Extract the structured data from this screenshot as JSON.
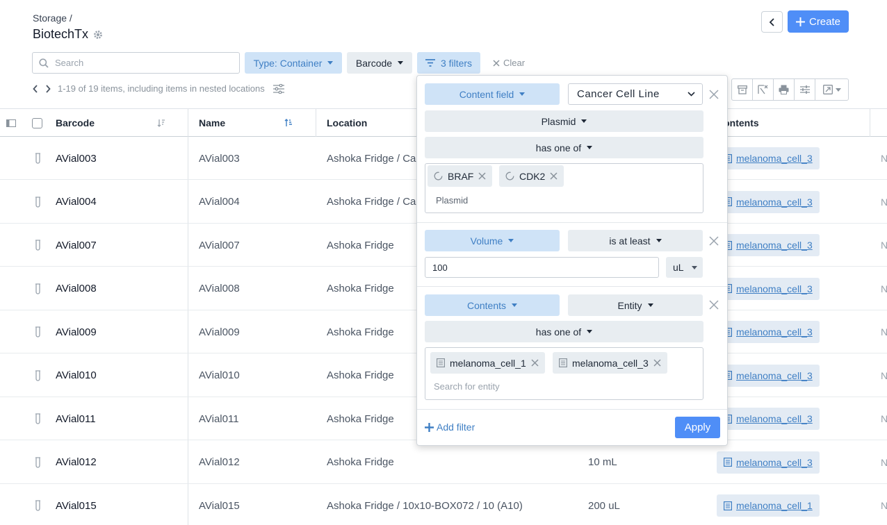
{
  "header": {
    "breadcrumb": "Storage /",
    "title": "BiotechTx",
    "create_label": "Create"
  },
  "toolbar": {
    "search_placeholder": "Search",
    "type_filter": "Type: Container",
    "barcode_filter": "Barcode",
    "filters_label": "3 filters",
    "clear_label": "Clear"
  },
  "pager": {
    "text": "1-19 of 19 items, including items in nested locations"
  },
  "table": {
    "columns": [
      "Barcode",
      "Name",
      "Location",
      "Contents"
    ],
    "rows": [
      {
        "barcode": "AVial003",
        "name": "AVial003",
        "location": "Ashoka Fridge / Ca",
        "volume": "",
        "contents": "melanoma_cell_3",
        "edge": "N"
      },
      {
        "barcode": "AVial004",
        "name": "AVial004",
        "location": "Ashoka Fridge / Ca",
        "volume": "",
        "contents": "melanoma_cell_3",
        "edge": "N"
      },
      {
        "barcode": "AVial007",
        "name": "AVial007",
        "location": "Ashoka Fridge",
        "volume": "",
        "contents": "melanoma_cell_3",
        "edge": "N"
      },
      {
        "barcode": "AVial008",
        "name": "AVial008",
        "location": "Ashoka Fridge",
        "volume": "",
        "contents": "melanoma_cell_3",
        "edge": "N"
      },
      {
        "barcode": "AVial009",
        "name": "AVial009",
        "location": "Ashoka Fridge",
        "volume": "",
        "contents": "melanoma_cell_3",
        "edge": "N"
      },
      {
        "barcode": "AVial010",
        "name": "AVial010",
        "location": "Ashoka Fridge",
        "volume": "",
        "contents": "melanoma_cell_3",
        "edge": "N"
      },
      {
        "barcode": "AVial011",
        "name": "AVial011",
        "location": "Ashoka Fridge",
        "volume": "",
        "contents": "melanoma_cell_3",
        "edge": "N"
      },
      {
        "barcode": "AVial012",
        "name": "AVial012",
        "location": "Ashoka Fridge",
        "volume": "10 mL",
        "contents": "melanoma_cell_3",
        "edge": "N"
      },
      {
        "barcode": "AVial015",
        "name": "AVial015",
        "location": "Ashoka Fridge / 10x10-BOX072 / 10 (A10)",
        "volume": "200 uL",
        "contents": "melanoma_cell_1",
        "edge": "N"
      }
    ]
  },
  "filter_popover": {
    "filter1": {
      "field": "Content field",
      "schema": "Cancer Cell Line",
      "property": "Plasmid",
      "operator": "has one of",
      "tags": [
        "BRAF",
        "CDK2"
      ],
      "box_label": "Plasmid"
    },
    "filter2": {
      "field": "Volume",
      "operator": "is at least",
      "value": "100",
      "unit": "uL"
    },
    "filter3": {
      "field": "Contents",
      "type": "Entity",
      "operator": "has one of",
      "tags": [
        "melanoma_cell_1",
        "melanoma_cell_3"
      ],
      "placeholder": "Search for entity"
    },
    "add_filter_label": "Add filter",
    "apply_label": "Apply"
  }
}
